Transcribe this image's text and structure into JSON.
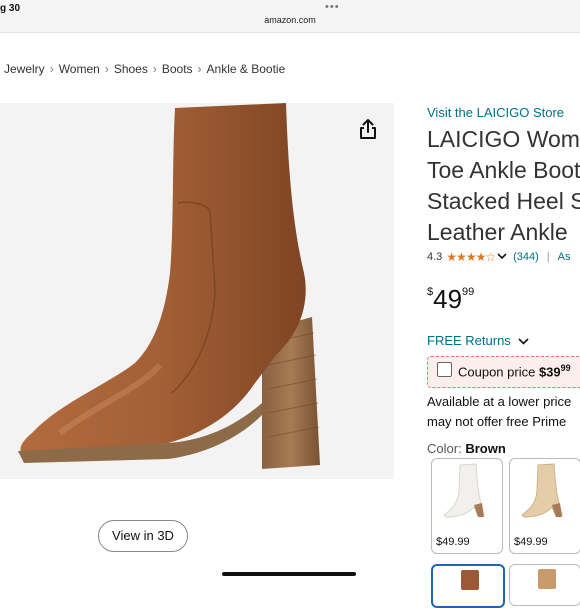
{
  "status": {
    "time": "g 30",
    "dots": "•••",
    "url": "amazon.com"
  },
  "breadcrumb": [
    "Jewelry",
    "Women",
    "Shoes",
    "Boots",
    "Ankle & Bootie"
  ],
  "breadcrumb_sep": "›",
  "product": {
    "store_link": "Visit the LAICIGO Store",
    "title_lines": [
      "LAICIGO Wome",
      "Toe Ankle Boot",
      "Stacked Heel S",
      "Leather Ankle "
    ],
    "rating": "4.3",
    "stars": "★★★★☆",
    "review_count": "(344)",
    "vbar": "|",
    "ask_link": "As",
    "price_currency": "$",
    "price_whole": "49",
    "price_fraction": "99",
    "free_returns": "FREE Returns",
    "coupon_label": "Coupon price",
    "coupon_price": "$39",
    "coupon_fraction": "99",
    "available_line1": "Available at a lower price",
    "available_line2": "may not offer free Prime",
    "color_label": "Color:",
    "color_value": "Brown",
    "variants": [
      {
        "name": "White",
        "price": "$49.99",
        "color": "#f2f0ec"
      },
      {
        "name": "Beige",
        "price": "$49.99",
        "color": "#e6cda9"
      }
    ],
    "variant_selected_color": "#1f63b4"
  },
  "image": {
    "view_3d_label": "View in 3D",
    "boot_color": "#9b5a34"
  },
  "colors": {
    "link": "#007185",
    "star": "#de7921",
    "coupon_bg": "#fdeeee"
  },
  "icons": {
    "share": "share-icon",
    "chevron": "chevron-down-icon"
  }
}
